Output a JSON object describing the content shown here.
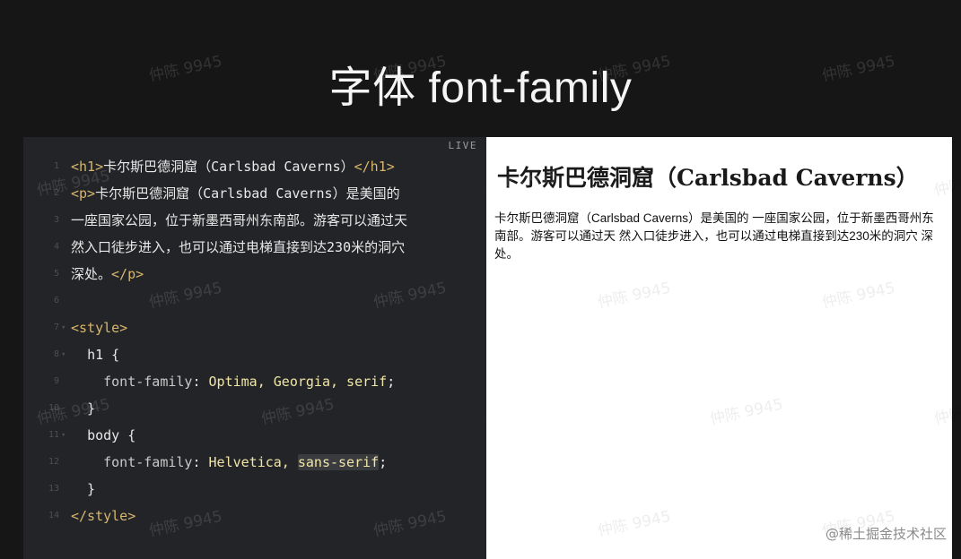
{
  "slide": {
    "title": "字体 font-family"
  },
  "editor": {
    "live_badge": "LIVE",
    "lines": [
      {
        "num": "1",
        "fold": "",
        "html": "<span class=\"tag\">&lt;h1&gt;</span>卡尔斯巴德洞窟（Carlsbad Caverns）<span class=\"tag\">&lt;/h1&gt;</span>"
      },
      {
        "num": "2",
        "fold": "",
        "html": "<span class=\"tag\">&lt;p&gt;</span>卡尔斯巴德洞窟（Carlsbad Caverns）是美国的"
      },
      {
        "num": "3",
        "fold": "",
        "html": "一座国家公园，位于新墨西哥州东南部。游客可以通过天"
      },
      {
        "num": "4",
        "fold": "",
        "html": "然入口徒步进入，也可以通过电梯直接到达230米的洞穴"
      },
      {
        "num": "5",
        "fold": "",
        "html": "深处。<span class=\"tag\">&lt;/p&gt;</span>"
      },
      {
        "num": "6",
        "fold": "",
        "html": ""
      },
      {
        "num": "7",
        "fold": "▾",
        "html": "<span class=\"tag\">&lt;style&gt;</span>"
      },
      {
        "num": "8",
        "fold": "▾",
        "html": "  <span class=\"sel\">h1 {</span>"
      },
      {
        "num": "9",
        "fold": "",
        "html": "    <span class=\"prop\">font-family</span>: <span class=\"val\">Optima, Georgia, serif</span>;"
      },
      {
        "num": "10",
        "fold": "",
        "html": "  }"
      },
      {
        "num": "11",
        "fold": "▾",
        "html": "  <span class=\"sel\">body {</span>"
      },
      {
        "num": "12",
        "fold": "",
        "html": "    <span class=\"prop\">font-family</span>: <span class=\"val\">Helvetica, <span class=\"hl\">sans-serif</span></span>;"
      },
      {
        "num": "13",
        "fold": "",
        "html": "  }"
      },
      {
        "num": "14",
        "fold": "",
        "html": "<span class=\"tag\">&lt;/style&gt;</span>"
      }
    ]
  },
  "preview": {
    "heading": "卡尔斯巴德洞窟（Carlsbad Caverns）",
    "paragraph": "卡尔斯巴德洞窟（Carlsbad Caverns）是美国的 一座国家公园，位于新墨西哥州东南部。游客可以通过天 然入口徒步进入，也可以通过电梯直接到达230米的洞穴 深处。"
  },
  "watermark_text": "仲陈 9945",
  "credit": "@稀土掘金技术社区"
}
